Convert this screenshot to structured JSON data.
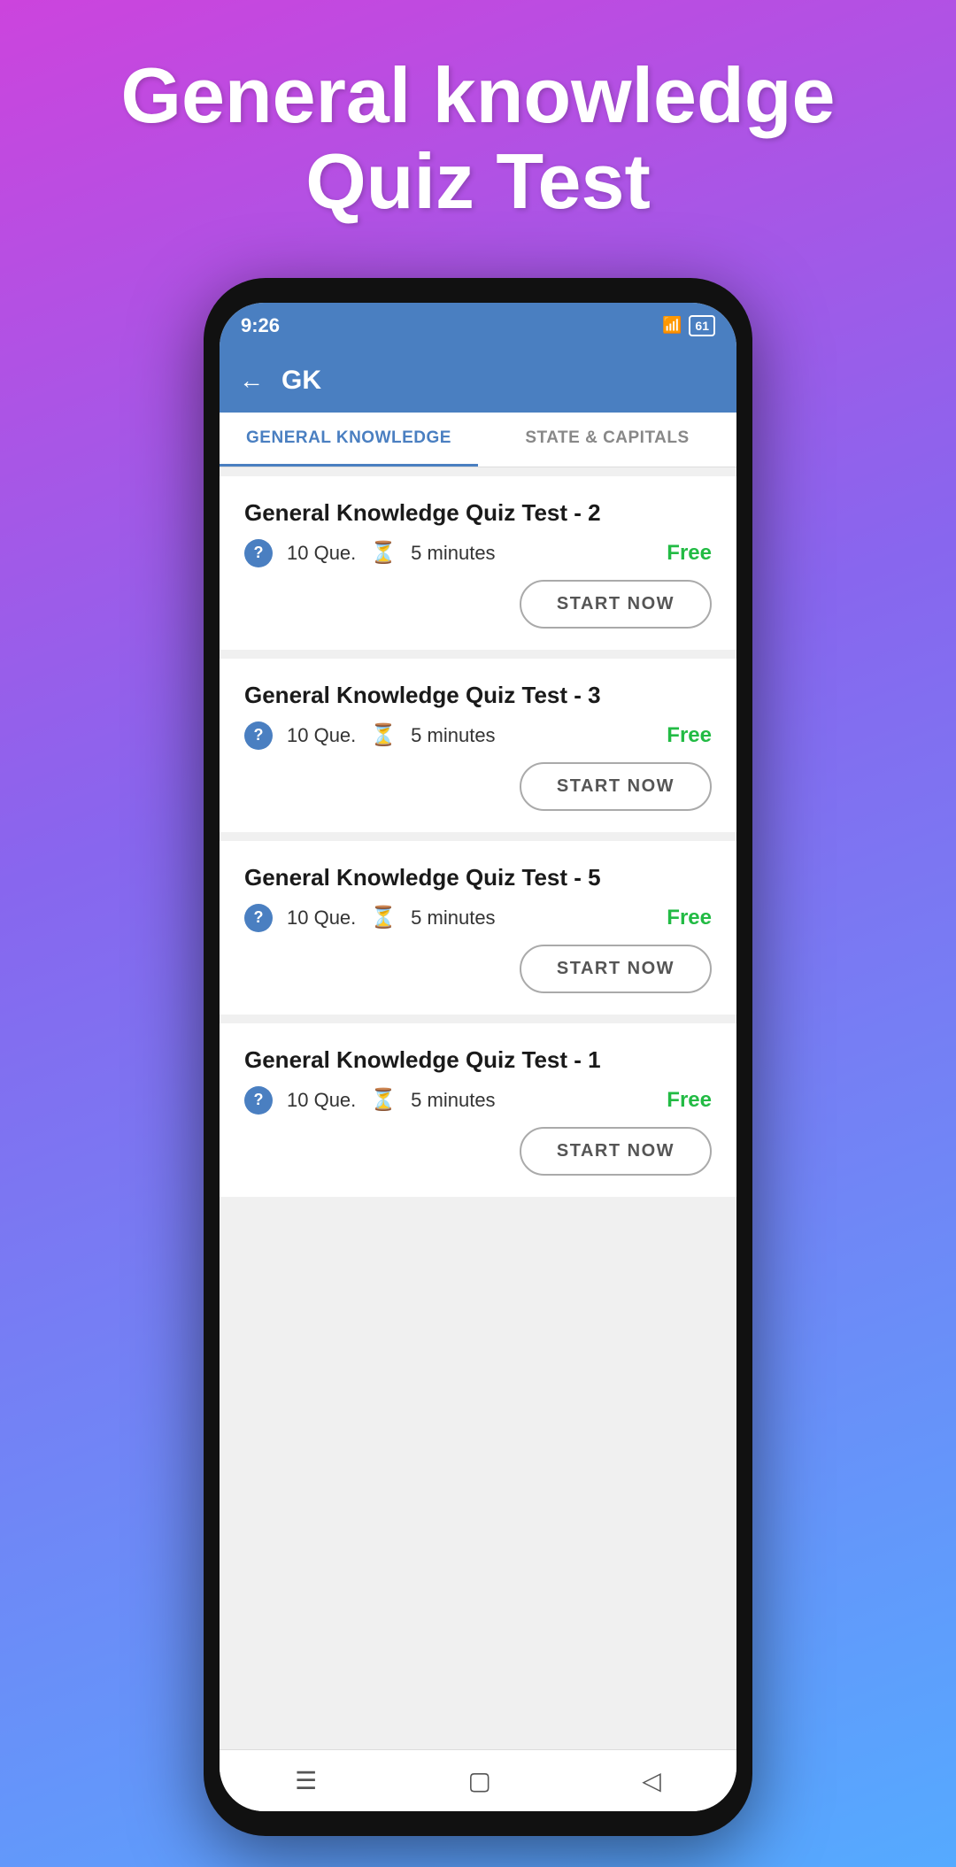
{
  "hero": {
    "title": "General knowledge Quiz Test"
  },
  "statusBar": {
    "time": "9:26",
    "signal": "4G",
    "battery": "61"
  },
  "appBar": {
    "back": "←",
    "title": "GK"
  },
  "tabs": [
    {
      "label": "GENERAL KNOWLEDGE",
      "active": true
    },
    {
      "label": "STATE & CAPITALS",
      "active": false
    }
  ],
  "quizCards": [
    {
      "title": "General Knowledge Quiz Test - 2",
      "questions": "10 Que.",
      "time": "5 minutes",
      "price": "Free",
      "btnLabel": "START NOW"
    },
    {
      "title": "General Knowledge Quiz Test - 3",
      "questions": "10 Que.",
      "time": "5 minutes",
      "price": "Free",
      "btnLabel": "START NOW"
    },
    {
      "title": "General Knowledge Quiz Test - 5",
      "questions": "10 Que.",
      "time": "5 minutes",
      "price": "Free",
      "btnLabel": "START NOW"
    },
    {
      "title": "General Knowledge Quiz Test - 1",
      "questions": "10 Que.",
      "time": "5 minutes",
      "price": "Free",
      "btnLabel": "START NOW"
    }
  ],
  "bottomNav": {
    "menu": "☰",
    "home": "▢",
    "back": "◁"
  }
}
